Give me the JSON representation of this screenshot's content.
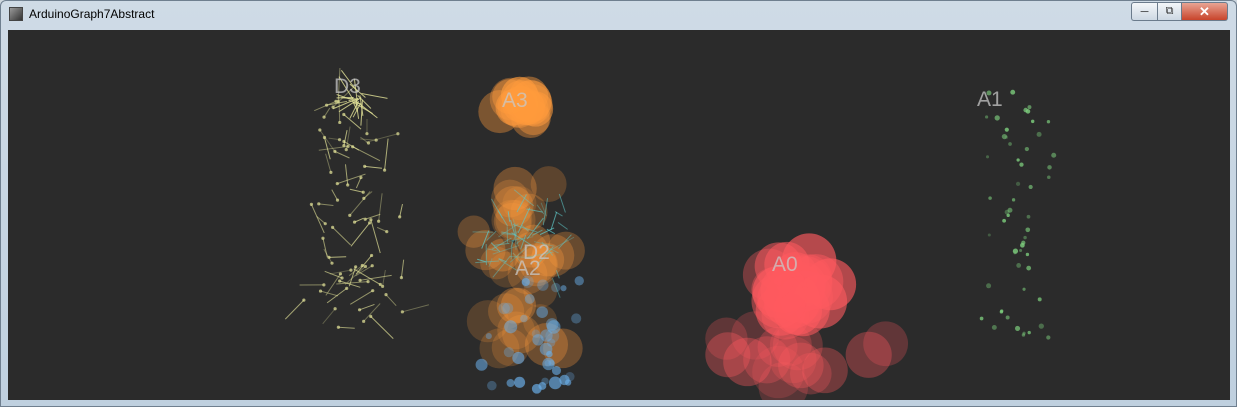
{
  "window": {
    "title": "ArduinoGraph7Abstract"
  },
  "channels": [
    {
      "name": "A0",
      "color": "#ff5a5f"
    },
    {
      "name": "A1",
      "color": "#7ed07e"
    },
    {
      "name": "A2",
      "color": "#6aaee8"
    },
    {
      "name": "A3",
      "color": "#ff9b3d"
    },
    {
      "name": "D2",
      "color": "#5ec8c8"
    },
    {
      "name": "D3",
      "color": "#e6e69a"
    }
  ]
}
